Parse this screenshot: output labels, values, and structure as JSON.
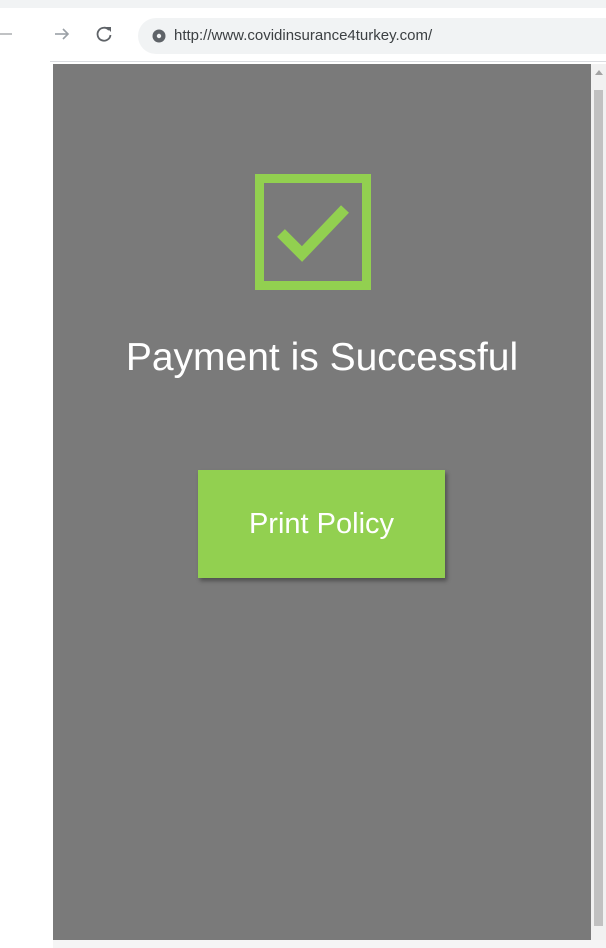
{
  "browser": {
    "url": "http://www.covidinsurance4turkey.com/",
    "icons": {
      "back": "arrow-left-icon",
      "forward": "arrow-right-icon",
      "reload": "reload-icon",
      "site_info": "info-icon"
    }
  },
  "page": {
    "heading": "Payment is Successful",
    "print_button_label": "Print Policy",
    "success_icon": "checkbox-checked-icon"
  },
  "colors": {
    "page_background": "#7a7a7a",
    "accent_green": "#92d050",
    "text_white": "#ffffff"
  }
}
